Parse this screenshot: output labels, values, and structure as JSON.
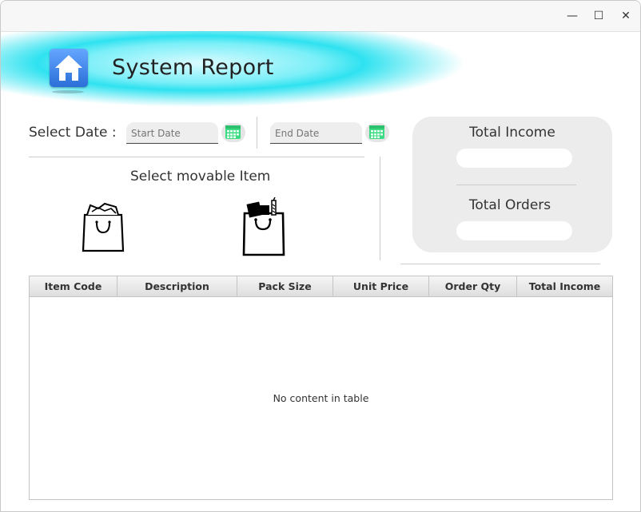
{
  "window": {
    "minimize_glyph": "—",
    "maximize_glyph": "☐",
    "close_glyph": "✕"
  },
  "header": {
    "title": "System Report",
    "icon": "home-icon"
  },
  "date_filter": {
    "label": "Select Date :",
    "start_placeholder": "Start Date",
    "end_placeholder": "End Date",
    "picker_icon": "calendar-icon",
    "picker_color": "#3ddc84"
  },
  "items": {
    "label": "Select movable Item",
    "icons": [
      "shopping-bag-icon",
      "grocery-bag-icon"
    ]
  },
  "summary": {
    "income_label": "Total Income",
    "income_value": "",
    "orders_label": "Total Orders",
    "orders_value": ""
  },
  "table": {
    "columns": [
      "Item Code",
      "Description",
      "Pack Size",
      "Unit Price",
      "Order Qty",
      "Total Income"
    ],
    "rows": [],
    "empty_text": "No content in table"
  },
  "colors": {
    "banner_accent": "#2fe2f0",
    "icon_blue": "#2b6fd8"
  }
}
